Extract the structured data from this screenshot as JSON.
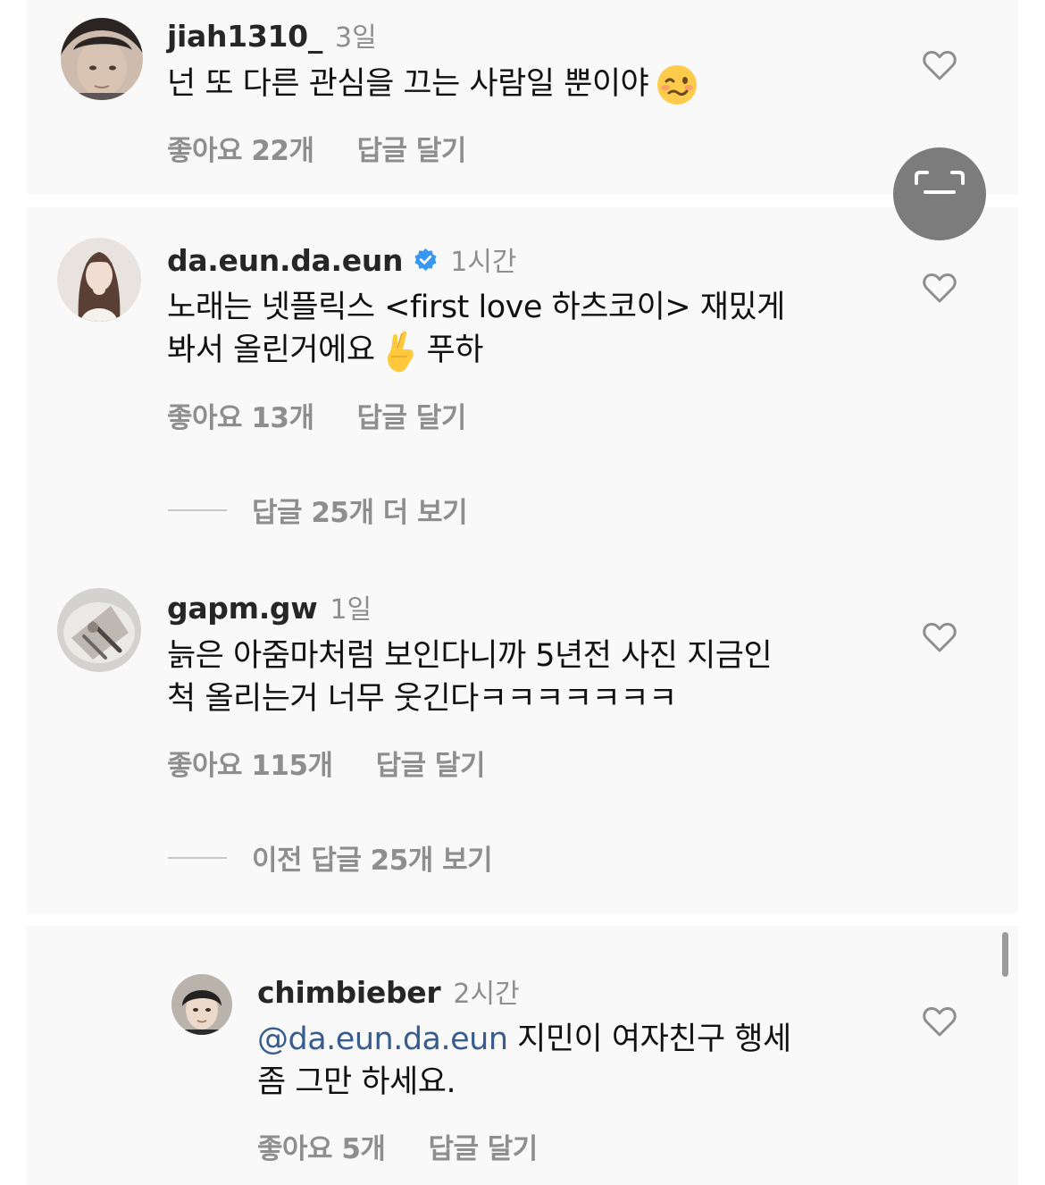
{
  "comments": [
    {
      "username": "jiah1310_",
      "time": "3일",
      "text": "넌 또 다른 관심을 끄는 사람일 뿐이야",
      "emoji": "woozy-face-emoji",
      "likes": "좋아요 22개",
      "reply": "답글 달기"
    },
    {
      "username": "da.eun.da.eun",
      "verified": true,
      "time": "1시간",
      "text_line1": "노래는 넷플릭스 <first love 하츠코이> 재밌게",
      "text_line2": "봐서 올린거에요",
      "text_line2_after": "푸하",
      "emoji": "crossed-fingers-emoji",
      "likes": "좋아요 13개",
      "reply": "답글 달기",
      "view_replies": "답글 25개 더 보기"
    },
    {
      "username": "gapm.gw",
      "time": "1일",
      "text_line1": "늙은 아줌마처럼 보인다니까 5년전 사진 지금인",
      "text_line2": "척 올리는거 너무 웃긴다ㅋㅋㅋㅋㅋㅋㅋ",
      "likes": "좋아요 115개",
      "reply": "답글 달기",
      "view_replies": "이전 답글 25개 보기"
    },
    {
      "username": "chimbieber",
      "time": "2시간",
      "mention": "@da.eun.da.eun",
      "text_line1_after": " 지민이 여자친구 행세",
      "text_line2": "좀 그만 하세요.",
      "likes": "좋아요 5개",
      "reply": "답글 달기"
    }
  ],
  "icons": {
    "like": "heart-outline-icon",
    "verified": "verified-badge-icon",
    "scan": "scan-icon"
  },
  "colors": {
    "panel_background": "#f9f9f9",
    "muted_text": "#8e8e8e",
    "mention": "#385c8e",
    "verified": "#3897f0"
  }
}
